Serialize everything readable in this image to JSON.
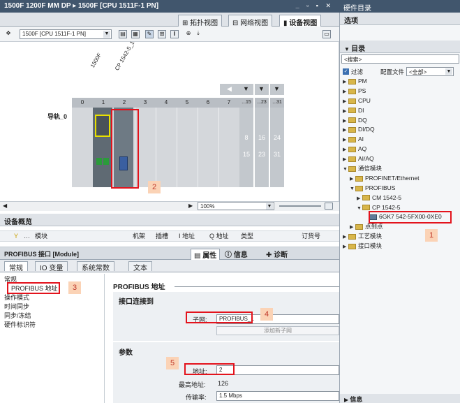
{
  "window": {
    "title": "1500F 1200F MM DP ▸ 1500F [CPU 1511F-1 PN]",
    "controls": "_ ▫ ▪ ✕"
  },
  "view_tabs": {
    "topology": "拓扑视图",
    "network": "网络视图",
    "device": "设备视图"
  },
  "toolbar": {
    "device_select": "1500F [CPU 1511F-1 PN]"
  },
  "rack": {
    "device_label_1": "1500F",
    "device_label_2": "CP 1542-5_1",
    "rail_label": "导轨_0",
    "slots": [
      "0",
      "1",
      "2",
      "3",
      "4",
      "5",
      "6",
      "7"
    ],
    "ext_slots": [
      "...15",
      "...23",
      "...31"
    ],
    "ext_top": [
      "8",
      "16",
      "24"
    ],
    "ext_bottom": [
      "15",
      "23",
      "31"
    ]
  },
  "zoom": {
    "value": "100%"
  },
  "device_overview": {
    "title": "设备概览",
    "columns": [
      "模块",
      "机架",
      "插槽",
      "I 地址",
      "Q 地址",
      "类型",
      "订货号"
    ]
  },
  "properties": {
    "header": "PROFIBUS 接口 [Module]",
    "tabs": {
      "props": "属性",
      "info": "信息",
      "diag": "诊断"
    },
    "subtabs": [
      "常规",
      "IO 变量",
      "系统常数",
      "文本"
    ],
    "nav": [
      "常规",
      "PROFIBUS 地址",
      "操作模式",
      "时间同步",
      "同步/冻结",
      "硬件标识符"
    ],
    "section_title": "PROFIBUS 地址",
    "interface_group": "接口连接到",
    "subnet_label": "子网:",
    "subnet_value": "PROFIBUS_1",
    "add_subnet_button": "添加新子网",
    "params_group": "参数",
    "address_label": "地址:",
    "address_value": "2",
    "highest_label": "最高地址:",
    "highest_value": "126",
    "rate_label": "传输率:",
    "rate_value": "1.5 Mbps"
  },
  "catalog": {
    "title": "硬件目录",
    "options": "选项",
    "catalog_header": "目录",
    "search_placeholder": "<搜索>",
    "filter_label": "过滤",
    "profile_label": "配置文件",
    "profile_value": "<全部>",
    "tree": [
      {
        "label": "PM",
        "level": 0,
        "open": false
      },
      {
        "label": "PS",
        "level": 0,
        "open": false
      },
      {
        "label": "CPU",
        "level": 0,
        "open": false
      },
      {
        "label": "DI",
        "level": 0,
        "open": false
      },
      {
        "label": "DQ",
        "level": 0,
        "open": false
      },
      {
        "label": "DI/DQ",
        "level": 0,
        "open": false
      },
      {
        "label": "AI",
        "level": 0,
        "open": false
      },
      {
        "label": "AQ",
        "level": 0,
        "open": false
      },
      {
        "label": "AI/AQ",
        "level": 0,
        "open": false
      },
      {
        "label": "通信模块",
        "level": 0,
        "open": true
      },
      {
        "label": "PROFINET/Ethernet",
        "level": 1,
        "open": false
      },
      {
        "label": "PROFIBUS",
        "level": 1,
        "open": true
      },
      {
        "label": "CM 1542-5",
        "level": 2,
        "open": false
      },
      {
        "label": "CP 1542-5",
        "level": 2,
        "open": true
      },
      {
        "label": "6GK7 542-5FX00-0XE0",
        "level": 3,
        "open": false
      },
      {
        "label": "点到点",
        "level": 1,
        "open": false
      },
      {
        "label": "工艺模块",
        "level": 0,
        "open": false
      },
      {
        "label": "接口模块",
        "level": 0,
        "open": false
      }
    ],
    "info_label": "信息"
  },
  "callouts": [
    "1",
    "2",
    "3",
    "4",
    "5"
  ],
  "colors": {
    "titlebar": "#41566d",
    "highlight": "#e3131c",
    "callout_bg": "#fbd3b6"
  }
}
